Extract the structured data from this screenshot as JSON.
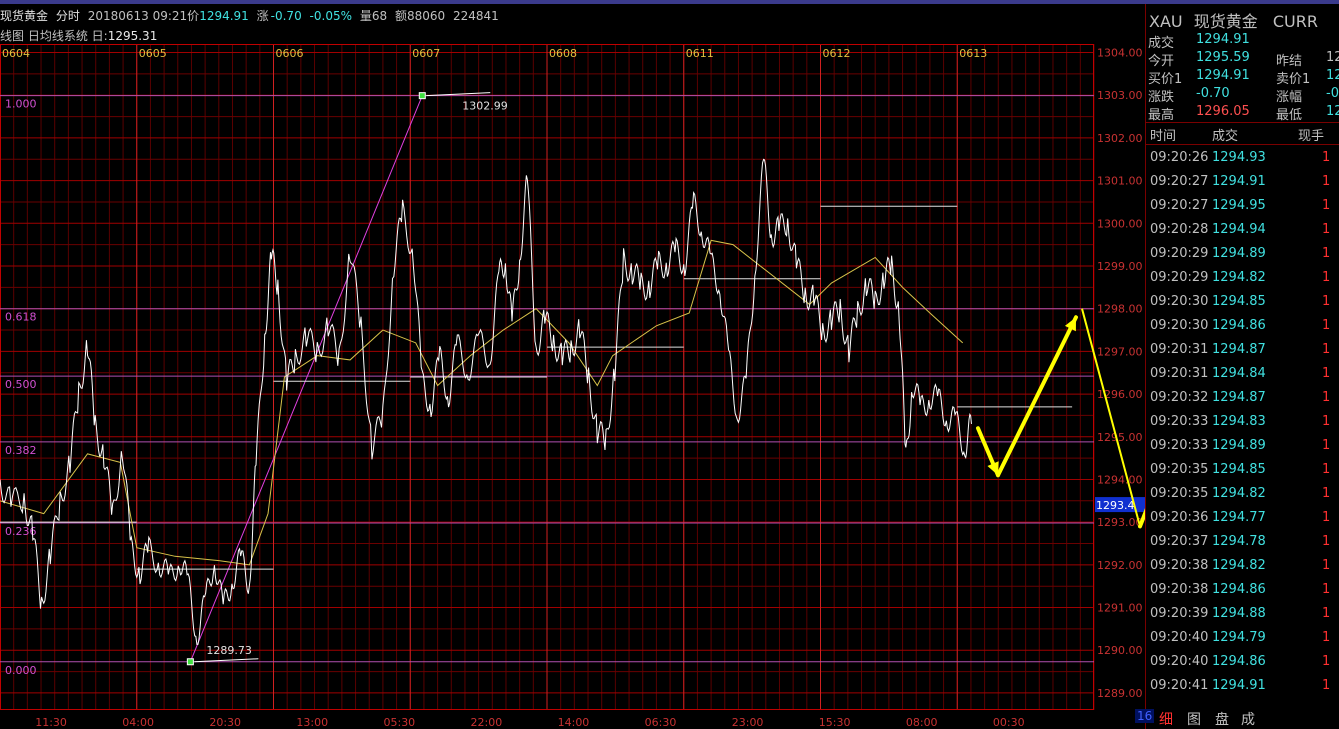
{
  "header": {
    "name": "现货黄金",
    "mode": "分时",
    "datetime": "20180613 09:21",
    "price_label": "价",
    "price": "1294.91",
    "change_label": "涨",
    "change": "-0.70",
    "change_pct": "-0.05%",
    "volume": "量68",
    "amount": "额88060",
    "open_interest": "224841"
  },
  "subheader": {
    "indicator": "线图 日均线系统",
    "ma_label": "日:",
    "ma_value": "1295.31"
  },
  "colors": {
    "grid": "#8b0000",
    "axis_text": "#c83232",
    "price_line": "#ffffff",
    "avg_line": "#d8c34a",
    "fib_line": "#b050b0",
    "fib_text": "#d050d0",
    "arrow": "#ffff00",
    "up": "#ff4040",
    "cyan": "#40e0e0"
  },
  "chart_data": {
    "type": "line",
    "title": "",
    "date_labels": [
      "0604",
      "0605",
      "0606",
      "0607",
      "0608",
      "0611",
      "0612",
      "0613"
    ],
    "x_tick_labels": [
      "11:30",
      "04:00",
      "20:30",
      "13:00",
      "05:30",
      "22:00",
      "14:00",
      "06:30",
      "23:00",
      "15:30",
      "08:00",
      "00:30"
    ],
    "y_ticks": [
      1289.0,
      1290.0,
      1291.0,
      1292.0,
      1293.0,
      1294.0,
      1295.0,
      1296.0,
      1297.0,
      1298.0,
      1299.0,
      1300.0,
      1301.0,
      1302.0,
      1303.0,
      1304.0
    ],
    "ylim": [
      1288.6,
      1304.2
    ],
    "current_price_tag": "1293.4",
    "fibonacci": [
      {
        "level": "1.000",
        "price": 1302.99
      },
      {
        "level": "0.618",
        "price": 1298.0
      },
      {
        "level": "0.500",
        "price": 1296.42
      },
      {
        "level": "0.382",
        "price": 1294.88
      },
      {
        "level": "0.236",
        "price": 1292.98
      },
      {
        "level": "0.000",
        "price": 1289.73
      }
    ],
    "annotations": [
      {
        "text": "1302.99",
        "price": 1302.99,
        "day": "0607"
      },
      {
        "text": "1289.73",
        "price": 1289.73,
        "day": "0605"
      }
    ],
    "price_path": [
      [
        0.0,
        1294.0
      ],
      [
        0.01,
        1293.4
      ],
      [
        0.022,
        1293.6
      ],
      [
        0.03,
        1292.7
      ],
      [
        0.038,
        1291.1
      ],
      [
        0.046,
        1292.2
      ],
      [
        0.055,
        1293.5
      ],
      [
        0.064,
        1294.4
      ],
      [
        0.072,
        1296.0
      ],
      [
        0.08,
        1297.2
      ],
      [
        0.087,
        1295.2
      ],
      [
        0.095,
        1294.6
      ],
      [
        0.103,
        1293.1
      ],
      [
        0.112,
        1294.8
      ],
      [
        0.12,
        1292.3
      ],
      [
        0.128,
        1291.9
      ],
      [
        0.136,
        1292.3
      ],
      [
        0.146,
        1292.1
      ],
      [
        0.155,
        1291.6
      ],
      [
        0.164,
        1292.2
      ],
      [
        0.172,
        1291.5
      ],
      [
        0.18,
        1290.4
      ],
      [
        0.188,
        1291.1
      ],
      [
        0.196,
        1292.2
      ],
      [
        0.204,
        1290.9
      ],
      [
        0.212,
        1291.7
      ],
      [
        0.22,
        1292.1
      ],
      [
        0.228,
        1291.6
      ],
      [
        0.234,
        1294.3
      ],
      [
        0.242,
        1297.4
      ],
      [
        0.248,
        1299.2
      ],
      [
        0.254,
        1298.6
      ],
      [
        0.262,
        1296.2
      ],
      [
        0.27,
        1296.9
      ],
      [
        0.28,
        1297.3
      ],
      [
        0.29,
        1297.0
      ],
      [
        0.3,
        1297.6
      ],
      [
        0.31,
        1296.8
      ],
      [
        0.32,
        1299.4
      ],
      [
        0.33,
        1297.5
      ],
      [
        0.34,
        1294.8
      ],
      [
        0.35,
        1295.4
      ],
      [
        0.36,
        1299.1
      ],
      [
        0.368,
        1300.2
      ],
      [
        0.378,
        1299.3
      ],
      [
        0.386,
        1296.2
      ],
      [
        0.394,
        1295.8
      ],
      [
        0.402,
        1296.8
      ],
      [
        0.41,
        1296.0
      ],
      [
        0.418,
        1297.1
      ],
      [
        0.428,
        1296.6
      ],
      [
        0.438,
        1297.2
      ],
      [
        0.448,
        1296.9
      ],
      [
        0.456,
        1298.7
      ],
      [
        0.462,
        1299.2
      ],
      [
        0.468,
        1297.6
      ],
      [
        0.475,
        1299.2
      ],
      [
        0.482,
        1301.0
      ],
      [
        0.49,
        1297.1
      ],
      [
        0.498,
        1297.7
      ],
      [
        0.506,
        1297.3
      ],
      [
        0.514,
        1296.8
      ],
      [
        0.522,
        1297.1
      ],
      [
        0.53,
        1297.5
      ],
      [
        0.538,
        1296.4
      ],
      [
        0.546,
        1295.1
      ],
      [
        0.554,
        1294.9
      ],
      [
        0.562,
        1296.6
      ],
      [
        0.57,
        1299.1
      ],
      [
        0.578,
        1298.9
      ],
      [
        0.586,
        1298.5
      ],
      [
        0.594,
        1298.6
      ],
      [
        0.602,
        1299.0
      ],
      [
        0.61,
        1299.1
      ],
      [
        0.618,
        1299.3
      ],
      [
        0.626,
        1299.1
      ],
      [
        0.634,
        1300.4
      ],
      [
        0.642,
        1299.9
      ],
      [
        0.65,
        1299.0
      ],
      [
        0.658,
        1298.6
      ],
      [
        0.666,
        1296.8
      ],
      [
        0.674,
        1295.6
      ],
      [
        0.682,
        1296.2
      ],
      [
        0.69,
        1298.9
      ],
      [
        0.698,
        1301.4
      ],
      [
        0.705,
        1299.8
      ],
      [
        0.712,
        1299.8
      ],
      [
        0.72,
        1300.1
      ],
      [
        0.728,
        1299.0
      ],
      [
        0.736,
        1298.4
      ],
      [
        0.744,
        1298.2
      ],
      [
        0.752,
        1297.5
      ],
      [
        0.76,
        1297.7
      ],
      [
        0.768,
        1298.0
      ],
      [
        0.776,
        1297.0
      ],
      [
        0.784,
        1297.9
      ],
      [
        0.792,
        1298.6
      ],
      [
        0.8,
        1298.1
      ],
      [
        0.808,
        1298.8
      ],
      [
        0.815,
        1298.9
      ],
      [
        0.822,
        1298.0
      ],
      [
        0.828,
        1294.4
      ],
      [
        0.834,
        1296.3
      ],
      [
        0.842,
        1295.6
      ],
      [
        0.85,
        1296.0
      ],
      [
        0.858,
        1295.8
      ],
      [
        0.866,
        1295.5
      ],
      [
        0.874,
        1295.3
      ],
      [
        0.882,
        1294.8
      ],
      [
        0.888,
        1295.3
      ]
    ],
    "avg_path": [
      [
        0.0,
        1293.5
      ],
      [
        0.04,
        1293.2
      ],
      [
        0.08,
        1294.6
      ],
      [
        0.11,
        1294.4
      ],
      [
        0.125,
        1292.4
      ],
      [
        0.16,
        1292.2
      ],
      [
        0.2,
        1292.1
      ],
      [
        0.228,
        1292.0
      ],
      [
        0.245,
        1293.2
      ],
      [
        0.26,
        1296.4
      ],
      [
        0.29,
        1296.9
      ],
      [
        0.32,
        1296.8
      ],
      [
        0.35,
        1297.5
      ],
      [
        0.38,
        1297.2
      ],
      [
        0.4,
        1296.2
      ],
      [
        0.43,
        1296.9
      ],
      [
        0.46,
        1297.5
      ],
      [
        0.49,
        1298.0
      ],
      [
        0.52,
        1297.2
      ],
      [
        0.546,
        1296.2
      ],
      [
        0.56,
        1296.9
      ],
      [
        0.6,
        1297.6
      ],
      [
        0.63,
        1297.9
      ],
      [
        0.65,
        1299.6
      ],
      [
        0.67,
        1299.5
      ],
      [
        0.7,
        1298.9
      ],
      [
        0.74,
        1298.1
      ],
      [
        0.76,
        1298.6
      ],
      [
        0.8,
        1299.2
      ],
      [
        0.825,
        1298.5
      ],
      [
        0.85,
        1297.9
      ],
      [
        0.88,
        1297.2
      ]
    ],
    "prev_close_steps": [
      {
        "from": 0.0,
        "to": 0.125,
        "price": 1293.0
      },
      {
        "from": 0.125,
        "to": 0.25,
        "price": 1291.9
      },
      {
        "from": 0.25,
        "to": 0.375,
        "price": 1296.3
      },
      {
        "from": 0.375,
        "to": 0.5,
        "price": 1296.4
      },
      {
        "from": 0.5,
        "to": 0.625,
        "price": 1297.1
      },
      {
        "from": 0.625,
        "to": 0.75,
        "price": 1298.7
      },
      {
        "from": 0.75,
        "to": 0.875,
        "price": 1300.4
      },
      {
        "from": 0.875,
        "to": 0.98,
        "price": 1295.7
      }
    ],
    "fib_trend_line": {
      "from": {
        "x": 0.174,
        "price": 1289.73
      },
      "to": {
        "x": 0.386,
        "price": 1302.99
      }
    }
  },
  "quote_panel": {
    "code": "XAU",
    "name": "现货黄金",
    "market": "CURR",
    "last_label": "成交",
    "last": "1294.91",
    "open_label": "今开",
    "open": "1295.59",
    "prev_label": "昨结",
    "prev": "12",
    "bid_label": "买价1",
    "bid": "1294.91",
    "ask_label": "卖价1",
    "ask": "12",
    "chg_label": "涨跌",
    "chg": "-0.70",
    "amp_label": "涨幅",
    "amp": "-0",
    "high_label": "最高",
    "high": "1296.05",
    "low_label": "最低",
    "low": "12"
  },
  "trades": {
    "headers": [
      "时间",
      "成交",
      "现手"
    ],
    "rows": [
      [
        "09:20:26",
        "1294.93",
        "1"
      ],
      [
        "09:20:27",
        "1294.91",
        "1"
      ],
      [
        "09:20:27",
        "1294.95",
        "1"
      ],
      [
        "09:20:28",
        "1294.94",
        "1"
      ],
      [
        "09:20:29",
        "1294.89",
        "1"
      ],
      [
        "09:20:29",
        "1294.82",
        "1"
      ],
      [
        "09:20:30",
        "1294.85",
        "1"
      ],
      [
        "09:20:30",
        "1294.86",
        "1"
      ],
      [
        "09:20:31",
        "1294.87",
        "1"
      ],
      [
        "09:20:31",
        "1294.84",
        "1"
      ],
      [
        "09:20:32",
        "1294.87",
        "1"
      ],
      [
        "09:20:33",
        "1294.83",
        "1"
      ],
      [
        "09:20:33",
        "1294.89",
        "1"
      ],
      [
        "09:20:35",
        "1294.85",
        "1"
      ],
      [
        "09:20:35",
        "1294.82",
        "1"
      ],
      [
        "09:20:36",
        "1294.77",
        "1"
      ],
      [
        "09:20:37",
        "1294.78",
        "1"
      ],
      [
        "09:20:38",
        "1294.82",
        "1"
      ],
      [
        "09:20:38",
        "1294.86",
        "1"
      ],
      [
        "09:20:39",
        "1294.88",
        "1"
      ],
      [
        "09:20:40",
        "1294.79",
        "1"
      ],
      [
        "09:20:40",
        "1294.86",
        "1"
      ],
      [
        "09:20:41",
        "1294.91",
        "1"
      ]
    ]
  },
  "tabs": [
    "细",
    "图",
    "盘",
    "成"
  ],
  "tab_prefix": "16"
}
